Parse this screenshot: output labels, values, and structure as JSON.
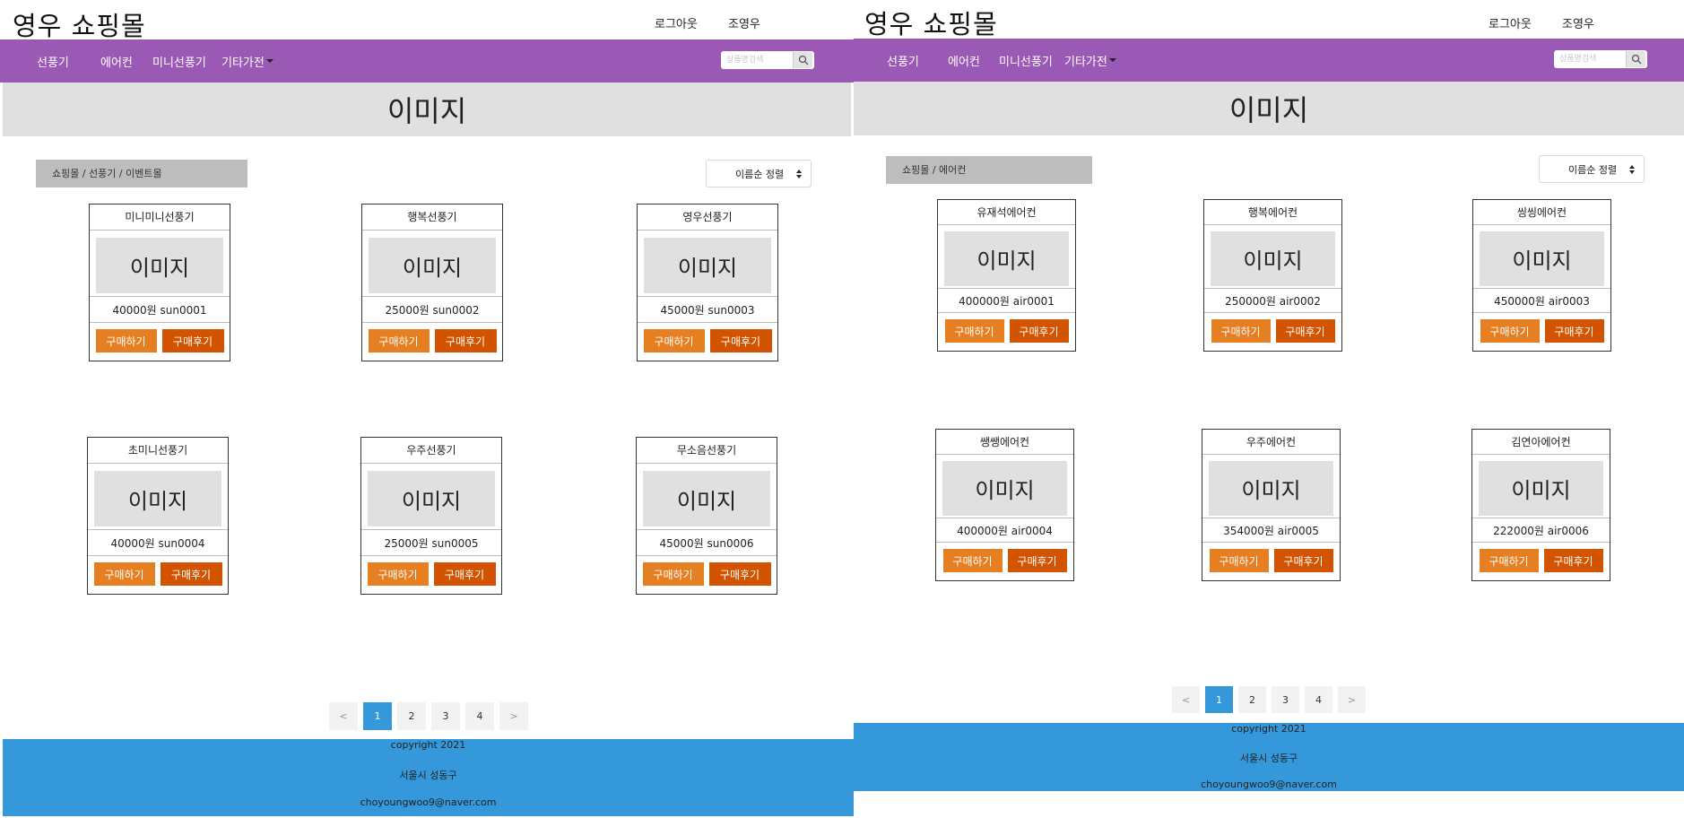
{
  "screens": [
    {
      "site_title": "영우 쇼핑몰",
      "header_links": {
        "logout": "로그아웃",
        "user": "조영우"
      },
      "nav": {
        "items": [
          "선풍기",
          "에어컨",
          "미니선풍기",
          "기타가전"
        ]
      },
      "search": {
        "placeholder": "상품명검색"
      },
      "banner": "이미지",
      "breadcrumb": "쇼핑몰 / 선풍기 / 이벤트몰",
      "sort": {
        "selected": "이름순 정렬"
      },
      "products": [
        {
          "name": "미니미니선풍기",
          "image": "이미지",
          "price_code": "40000원 sun0001",
          "buy": "구매하기",
          "review": "구매후기"
        },
        {
          "name": "행복선풍기",
          "image": "이미지",
          "price_code": "25000원 sun0002",
          "buy": "구매하기",
          "review": "구매후기"
        },
        {
          "name": "영우선풍기",
          "image": "이미지",
          "price_code": "45000원 sun0003",
          "buy": "구매하기",
          "review": "구매후기"
        },
        {
          "name": "초미니선풍기",
          "image": "이미지",
          "price_code": "40000원 sun0004",
          "buy": "구매하기",
          "review": "구매후기"
        },
        {
          "name": "우주선풍기",
          "image": "이미지",
          "price_code": "25000원 sun0005",
          "buy": "구매하기",
          "review": "구매후기"
        },
        {
          "name": "무소음선풍기",
          "image": "이미지",
          "price_code": "45000원 sun0006",
          "buy": "구매하기",
          "review": "구매후기"
        }
      ],
      "pagination": {
        "prev": "<",
        "pages": [
          "1",
          "2",
          "3",
          "4"
        ],
        "next": ">",
        "active": "1"
      },
      "footer": {
        "copyright": "copyright 2021",
        "address": "서울시 성동구",
        "email": "choyoungwoo9@naver.com"
      }
    },
    {
      "site_title": "영우 쇼핑몰",
      "header_links": {
        "logout": "로그아웃",
        "user": "조영우"
      },
      "nav": {
        "items": [
          "선풍기",
          "에어컨",
          "미니선풍기",
          "기타가전"
        ]
      },
      "search": {
        "placeholder": "상품명검색"
      },
      "banner": "이미지",
      "breadcrumb": "쇼핑몰 / 에어컨",
      "sort": {
        "selected": "이름순 정렬"
      },
      "products": [
        {
          "name": "유재석에어컨",
          "image": "이미지",
          "price_code": "400000원 air0001",
          "buy": "구매하기",
          "review": "구매후기"
        },
        {
          "name": "행복에어컨",
          "image": "이미지",
          "price_code": "250000원 air0002",
          "buy": "구매하기",
          "review": "구매후기"
        },
        {
          "name": "씽씽에어컨",
          "image": "이미지",
          "price_code": "450000원 air0003",
          "buy": "구매하기",
          "review": "구매후기"
        },
        {
          "name": "쌩쌩에어컨",
          "image": "이미지",
          "price_code": "400000원 air0004",
          "buy": "구매하기",
          "review": "구매후기"
        },
        {
          "name": "우주에어컨",
          "image": "이미지",
          "price_code": "354000원 air0005",
          "buy": "구매하기",
          "review": "구매후기"
        },
        {
          "name": "김연아에어컨",
          "image": "이미지",
          "price_code": "222000원 air0006",
          "buy": "구매하기",
          "review": "구매후기"
        }
      ],
      "pagination": {
        "prev": "<",
        "pages": [
          "1",
          "2",
          "3",
          "4"
        ],
        "next": ">",
        "active": "1"
      },
      "footer": {
        "copyright": "copyright 2021",
        "address": "서울시 성동구",
        "email": "choyoungwoo9@naver.com"
      }
    }
  ]
}
